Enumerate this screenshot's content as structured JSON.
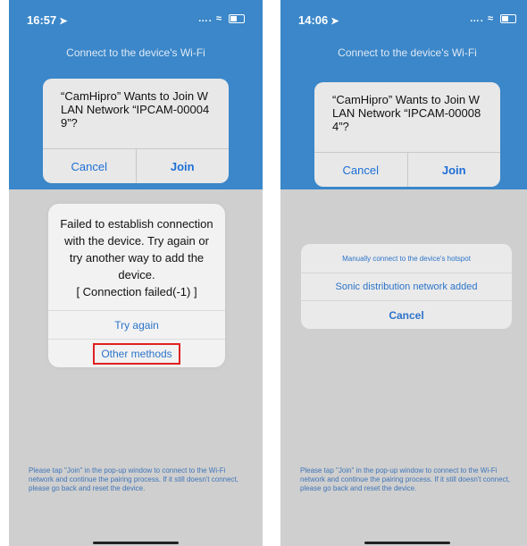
{
  "left": {
    "status": {
      "time": "16:57",
      "signal": "…. ",
      "wifi": "≈"
    },
    "header_title": "Connect to the device's Wi-Fi",
    "wifi_alert": {
      "message": "“CamHipro” Wants to Join W LAN Network “IPCAM-00004 9”?",
      "cancel": "Cancel",
      "join": "Join"
    },
    "error_dialog": {
      "line1": "Failed to establish connection",
      "line2": "with the device. Try again or",
      "line3": "try another way to add the",
      "line4": "device.",
      "line5": "[ Connection failed(-1) ]",
      "try_again": "Try again",
      "other_methods": "Other methods"
    },
    "footer_note": "Please tap \"Join\" in the pop-up window to connect to the Wi-Fi network and continue the pairing process. If it still doesn't connect, please go back and reset the device."
  },
  "right": {
    "status": {
      "time": "14:06",
      "signal": "…. ",
      "wifi": "≈"
    },
    "header_title": "Connect to the device's Wi-Fi",
    "wifi_alert": {
      "message": "“CamHipro” Wants to Join W LAN Network “IPCAM-00008 4”?",
      "cancel": "Cancel",
      "join": "Join"
    },
    "action_sheet": {
      "option1": "Manually connect to the device's hotspot",
      "option2": "Sonic distribution network added",
      "cancel": "Cancel"
    },
    "footer_note": "Please tap \"Join\" in the pop-up window to connect to the Wi-Fi network and continue the pairing process. If it still doesn't connect, please go back and reset the device."
  },
  "colors": {
    "header_blue": "#3b87c9",
    "link_blue": "#2c74c9",
    "highlight_red": "#e02020",
    "backdrop_gray": "#cfcfcf"
  }
}
